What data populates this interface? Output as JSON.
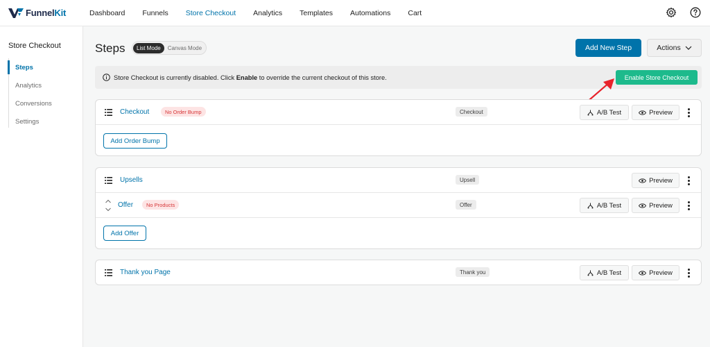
{
  "brand": {
    "name_main": "Funnel",
    "name_kit": "Kit"
  },
  "nav": {
    "items": [
      {
        "label": "Dashboard"
      },
      {
        "label": "Funnels"
      },
      {
        "label": "Store Checkout",
        "active": true
      },
      {
        "label": "Analytics"
      },
      {
        "label": "Templates"
      },
      {
        "label": "Automations"
      },
      {
        "label": "Cart"
      }
    ],
    "icons": [
      "gear-icon",
      "help-icon"
    ]
  },
  "sidebar": {
    "title": "Store Checkout",
    "items": [
      {
        "label": "Steps",
        "active": true
      },
      {
        "label": "Analytics"
      },
      {
        "label": "Conversions"
      },
      {
        "label": "Settings"
      }
    ]
  },
  "header": {
    "title": "Steps",
    "mode_list": "List Mode",
    "mode_canvas": "Canvas Mode",
    "add_step": "Add New Step",
    "actions": "Actions"
  },
  "notice": {
    "prefix": "Store Checkout is currently disabled. Click ",
    "bold": "Enable",
    "suffix": " to override the current checkout of this store.",
    "button": "Enable Store Checkout"
  },
  "steps": {
    "checkout": {
      "name": "Checkout",
      "badge": "No Order Bump",
      "type": "Checkout",
      "ab": "A/B Test",
      "preview": "Preview",
      "add": "Add Order Bump"
    },
    "upsells": {
      "name": "Upsells",
      "type": "Upsell",
      "preview": "Preview"
    },
    "offer": {
      "name": "Offer",
      "badge": "No Products",
      "type": "Offer",
      "ab": "A/B Test",
      "preview": "Preview",
      "add": "Add Offer"
    },
    "thankyou": {
      "name": "Thank you Page",
      "type": "Thank you",
      "ab": "A/B Test",
      "preview": "Preview"
    }
  },
  "colors": {
    "accent": "#0073aa",
    "enable": "#1dba8c",
    "badge_red": "#d63638",
    "arrow": "#e8232b"
  }
}
